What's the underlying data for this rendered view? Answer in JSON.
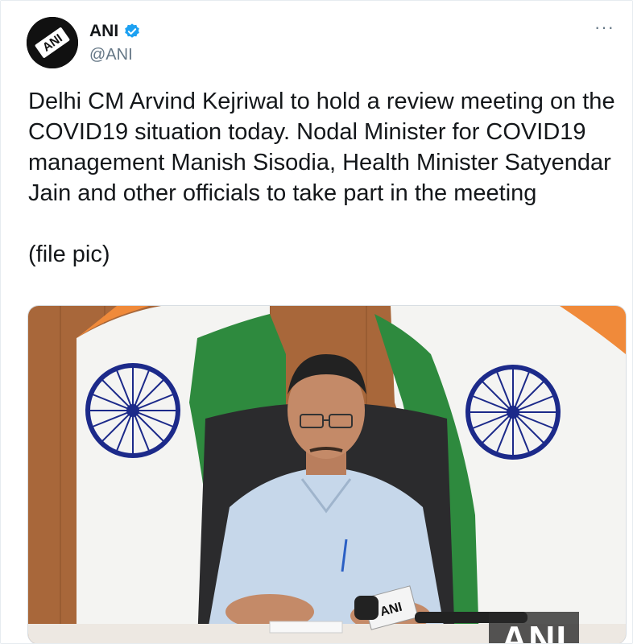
{
  "tweet": {
    "display_name": "ANI",
    "handle": "@ANI",
    "verified_icon": "verified-badge-icon",
    "avatar_label": "ANI",
    "more_label": "···",
    "text_lines": [
      "Delhi CM Arvind Kejriwal to hold a review meeting on the COVID19 situation today. Nodal Minister for COVID19 management Manish Sisodia, Health Minister Satyendar Jain and other officials to take part in the meeting",
      "(file pic)"
    ],
    "media": {
      "watermark": "ANI",
      "mic_label": "ANI"
    }
  },
  "colors": {
    "verified": "#1da1f2",
    "saffron": "#f08a3a",
    "green": "#2e8a3e",
    "chakra": "#1c2a8a",
    "wood": "#a8673a"
  }
}
